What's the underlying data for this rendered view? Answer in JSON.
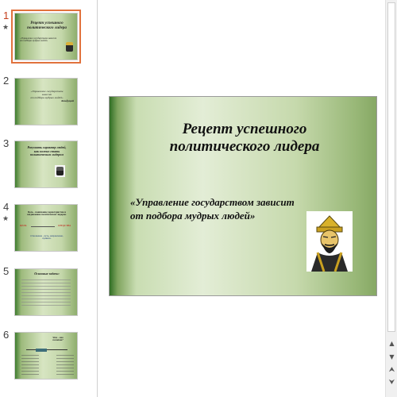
{
  "thumbnails": [
    {
      "number": "1",
      "star": "★",
      "lines": [
        "Рецепт успешного",
        "политического лидера"
      ],
      "quote": [
        "«Управление государством зависит",
        "от подбора мудрых людей»"
      ]
    },
    {
      "number": "2",
      "lines": [
        "«Управление государством",
        "зависит",
        "от подбора мудрых людей»",
        "Конфуций"
      ]
    },
    {
      "number": "3",
      "lines": [
        "Разузнать характер людей,",
        "как можно стать",
        "политическим лидером"
      ]
    },
    {
      "number": "4",
      "star": "★",
      "lines": [
        "Цель - понимание характеристик и",
        "выдвижение политических лидеров."
      ],
      "labels": [
        "ЦЕЛЬ",
        "СРЕДСТВА"
      ],
      "bottom": [
        "Отношение - путь, направление,",
        "правила."
      ]
    },
    {
      "number": "5",
      "lines": [
        "Основные задачи:"
      ]
    },
    {
      "number": "6",
      "lines": [
        "Что - это",
        "политик?"
      ]
    }
  ],
  "slide": {
    "title_line1": "Рецепт успешного",
    "title_line2": "политического лидера",
    "quote_line1": "«Управление государством зависит",
    "quote_line2": "от подбора мудрых людей»"
  },
  "icons": {
    "star": "star-icon",
    "portrait": "confucius-portrait",
    "scroll_up": "scroll-up-icon",
    "scroll_down": "scroll-down-icon"
  },
  "colors": {
    "selection": "#e1723d",
    "active_number": "#c43e1c",
    "slide_green_dark": "#2f6e24",
    "slide_green_light": "#e3edd6"
  }
}
